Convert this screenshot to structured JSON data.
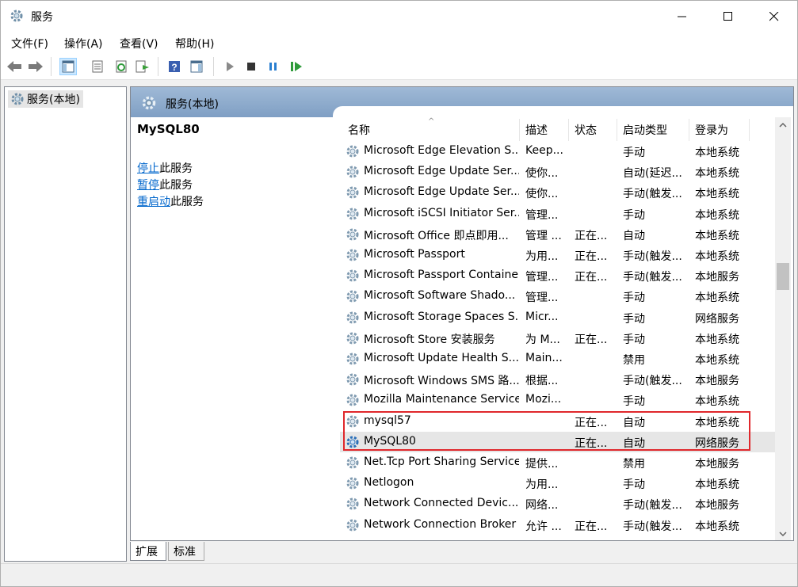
{
  "window": {
    "title": "服务",
    "controls": [
      "minimize",
      "maximize",
      "close"
    ]
  },
  "menu": {
    "items": [
      {
        "label": "文件(F)"
      },
      {
        "label": "操作(A)"
      },
      {
        "label": "查看(V)"
      },
      {
        "label": "帮助(H)"
      }
    ]
  },
  "toolbar": {
    "icons": [
      "back-arrow-icon",
      "forward-arrow-icon",
      "console-tree-icon",
      "properties-icon",
      "refresh-icon",
      "export-list-icon",
      "help-icon",
      "action-pane-icon",
      "start-service-icon",
      "stop-service-icon",
      "pause-service-icon",
      "restart-service-icon"
    ]
  },
  "tree": {
    "root_label": "服务(本地)"
  },
  "pane": {
    "header_title": "服务(本地)",
    "selected_service": "MySQL80",
    "actions": [
      {
        "link": "停止",
        "suffix": "此服务"
      },
      {
        "link": "暂停",
        "suffix": "此服务"
      },
      {
        "link": "重启动",
        "suffix": "此服务"
      }
    ]
  },
  "table": {
    "columns": [
      "名称",
      "描述",
      "状态",
      "启动类型",
      "登录为"
    ],
    "rows": [
      {
        "name": "Microsoft Edge Elevation S...",
        "desc": "Keep...",
        "status": "",
        "startup": "手动",
        "logon": "本地系统"
      },
      {
        "name": "Microsoft Edge Update Ser...",
        "desc": "使你...",
        "status": "",
        "startup": "自动(延迟...",
        "logon": "本地系统"
      },
      {
        "name": "Microsoft Edge Update Ser...",
        "desc": "使你...",
        "status": "",
        "startup": "手动(触发...",
        "logon": "本地系统"
      },
      {
        "name": "Microsoft iSCSI Initiator Ser...",
        "desc": "管理...",
        "status": "",
        "startup": "手动",
        "logon": "本地系统"
      },
      {
        "name": "Microsoft Office 即点即用...",
        "desc": "管理 ...",
        "status": "正在...",
        "startup": "自动",
        "logon": "本地系统"
      },
      {
        "name": "Microsoft Passport",
        "desc": "为用...",
        "status": "正在...",
        "startup": "手动(触发...",
        "logon": "本地系统"
      },
      {
        "name": "Microsoft Passport Container",
        "desc": "管理...",
        "status": "正在...",
        "startup": "手动(触发...",
        "logon": "本地服务"
      },
      {
        "name": "Microsoft Software Shado...",
        "desc": "管理...",
        "status": "",
        "startup": "手动",
        "logon": "本地系统"
      },
      {
        "name": "Microsoft Storage Spaces S...",
        "desc": "Micr...",
        "status": "",
        "startup": "手动",
        "logon": "网络服务"
      },
      {
        "name": "Microsoft Store 安装服务",
        "desc": "为 M...",
        "status": "正在...",
        "startup": "手动",
        "logon": "本地系统"
      },
      {
        "name": "Microsoft Update Health S...",
        "desc": "Main...",
        "status": "",
        "startup": "禁用",
        "logon": "本地系统"
      },
      {
        "name": "Microsoft Windows SMS 路...",
        "desc": "根据...",
        "status": "",
        "startup": "手动(触发...",
        "logon": "本地服务"
      },
      {
        "name": "Mozilla Maintenance Service",
        "desc": "Mozi...",
        "status": "",
        "startup": "手动",
        "logon": "本地系统"
      },
      {
        "name": "mysql57",
        "desc": "",
        "status": "正在...",
        "startup": "自动",
        "logon": "本地系统"
      },
      {
        "name": "MySQL80",
        "desc": "",
        "status": "正在...",
        "startup": "自动",
        "logon": "网络服务"
      },
      {
        "name": "Net.Tcp Port Sharing Service",
        "desc": "提供...",
        "status": "",
        "startup": "禁用",
        "logon": "本地服务"
      },
      {
        "name": "Netlogon",
        "desc": "为用...",
        "status": "",
        "startup": "手动",
        "logon": "本地系统"
      },
      {
        "name": "Network Connected Devic...",
        "desc": "网络...",
        "status": "",
        "startup": "手动(触发...",
        "logon": "本地服务"
      },
      {
        "name": "Network Connection Broker",
        "desc": "允许 ...",
        "status": "正在...",
        "startup": "手动(触发...",
        "logon": "本地系统"
      }
    ]
  },
  "tabs": [
    {
      "label": "扩展"
    },
    {
      "label": "标准"
    }
  ],
  "colors": {
    "header_blue": "#7f9fc4",
    "link_blue": "#0066cc",
    "highlight_red": "#e0282c",
    "selected_row": "#e6e6e6"
  }
}
